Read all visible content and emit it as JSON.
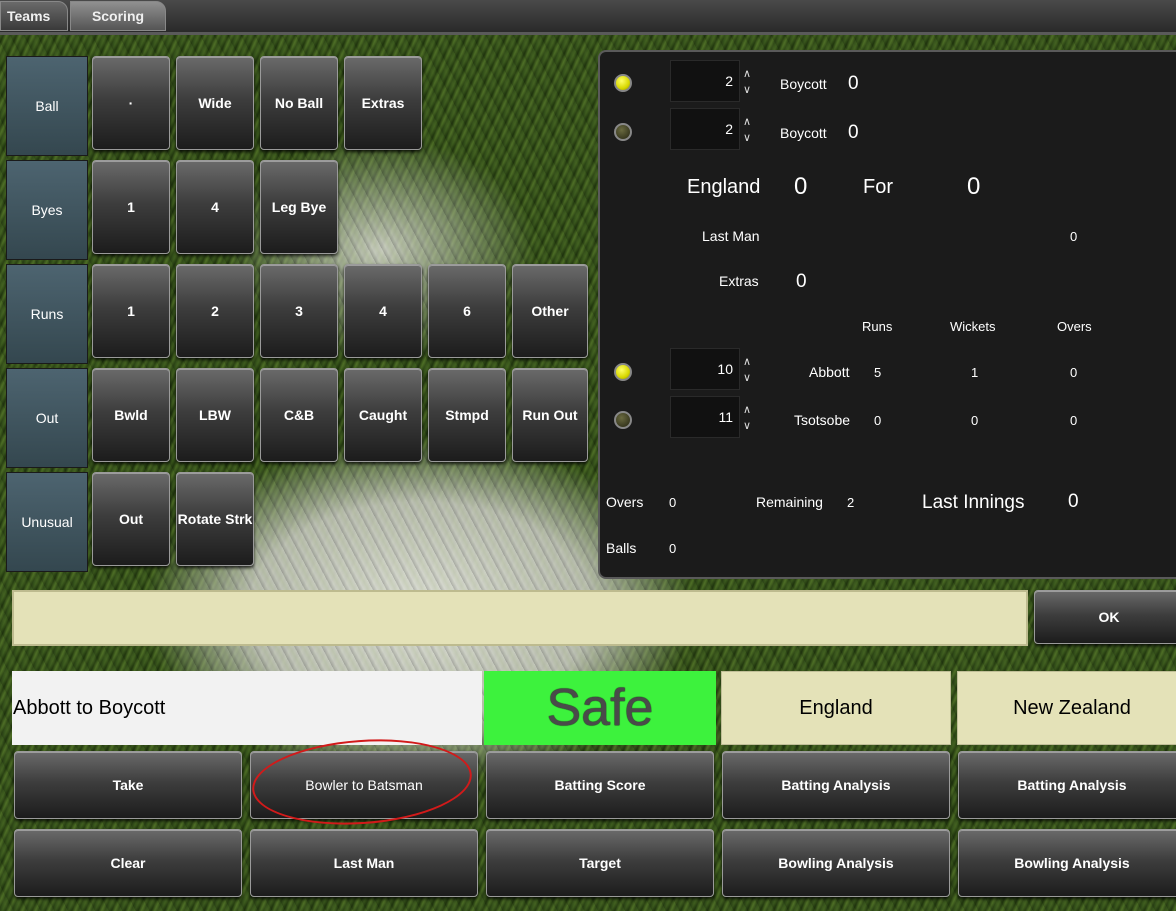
{
  "tabs": [
    "Teams",
    "Scoring"
  ],
  "grid": {
    "rows": [
      {
        "label": "Ball",
        "buttons": [
          "·",
          "Wide",
          "No Ball",
          "Extras"
        ]
      },
      {
        "label": "Byes",
        "buttons": [
          "1",
          "4",
          "Leg Bye"
        ]
      },
      {
        "label": "Runs",
        "buttons": [
          "1",
          "2",
          "3",
          "4",
          "6",
          "Other"
        ]
      },
      {
        "label": "Out",
        "buttons": [
          "Bwld",
          "LBW",
          "C&B",
          "Caught",
          "Stmpd",
          "Run Out"
        ]
      },
      {
        "label": "Unusual",
        "buttons": [
          "Out",
          "Rotate Strk"
        ]
      }
    ]
  },
  "panel": {
    "batsmen": [
      {
        "number": "2",
        "name": "Boycott",
        "score": "0",
        "on_strike": true
      },
      {
        "number": "2",
        "name": "Boycott",
        "score": "0",
        "on_strike": false
      }
    ],
    "team_label": "England",
    "team_score": "0",
    "for_label": "For",
    "for_value": "0",
    "last_man_label": "Last Man",
    "last_man_value": "0",
    "extras_label": "Extras",
    "extras_value": "0",
    "bowling_headers": [
      "Runs",
      "Wickets",
      "Overs"
    ],
    "bowlers": [
      {
        "number": "10",
        "name": "Abbott",
        "runs": "5",
        "wickets": "1",
        "overs": "0",
        "active": true
      },
      {
        "number": "11",
        "name": "Tsotsobe",
        "runs": "0",
        "wickets": "0",
        "overs": "0",
        "active": false
      }
    ],
    "overs_label": "Overs",
    "overs_value": "0",
    "remaining_label": "Remaining",
    "remaining_value": "2",
    "last_innings_label": "Last Innings",
    "last_innings_value": "0",
    "balls_label": "Balls",
    "balls_value": "0"
  },
  "entry": {
    "value": ""
  },
  "ok_label": "OK",
  "status": {
    "description": "Abbott to Boycott",
    "result": "Safe",
    "result_color": "#3df23d",
    "team1": "England",
    "team2": "New Zealand"
  },
  "bottom": {
    "row1": [
      "Take",
      "Bowler to Batsman",
      "Batting Score",
      "Batting Analysis",
      "Batting Analysis"
    ],
    "row2": [
      "Clear",
      "Last Man",
      "Target",
      "Bowling Analysis",
      "Bowling Analysis"
    ]
  }
}
